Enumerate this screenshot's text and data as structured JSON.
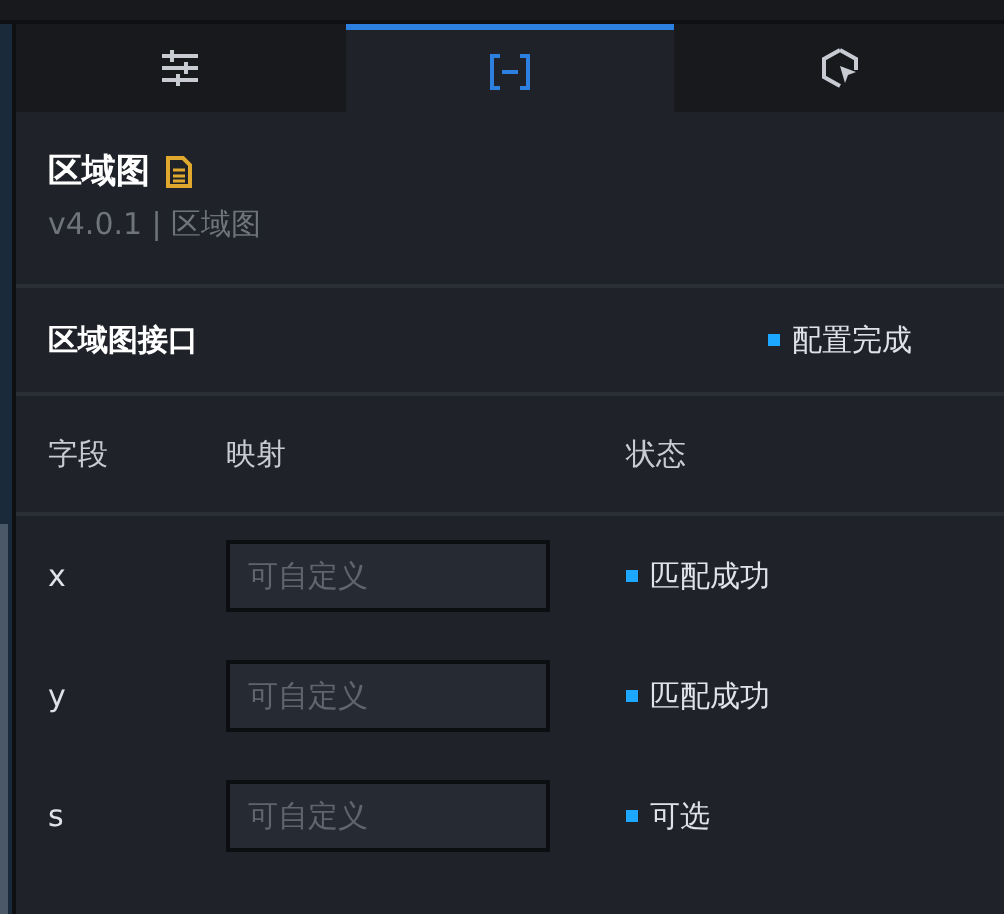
{
  "tabs": [
    {
      "kind": "sliders",
      "selected": false
    },
    {
      "kind": "brackets",
      "selected": true
    },
    {
      "kind": "cursor",
      "selected": false
    }
  ],
  "component": {
    "title": "区域图",
    "version": "v4.0.1 | 区域图"
  },
  "interface": {
    "title": "区域图接口",
    "status": "配置完成"
  },
  "fields_table": {
    "columns": [
      "字段",
      "映射",
      "状态"
    ],
    "rows": [
      {
        "field": "x",
        "placeholder": "可自定义",
        "status": "匹配成功"
      },
      {
        "field": "y",
        "placeholder": "可自定义",
        "status": "匹配成功"
      },
      {
        "field": "s",
        "placeholder": "可自定义",
        "status": "可选"
      }
    ]
  }
}
